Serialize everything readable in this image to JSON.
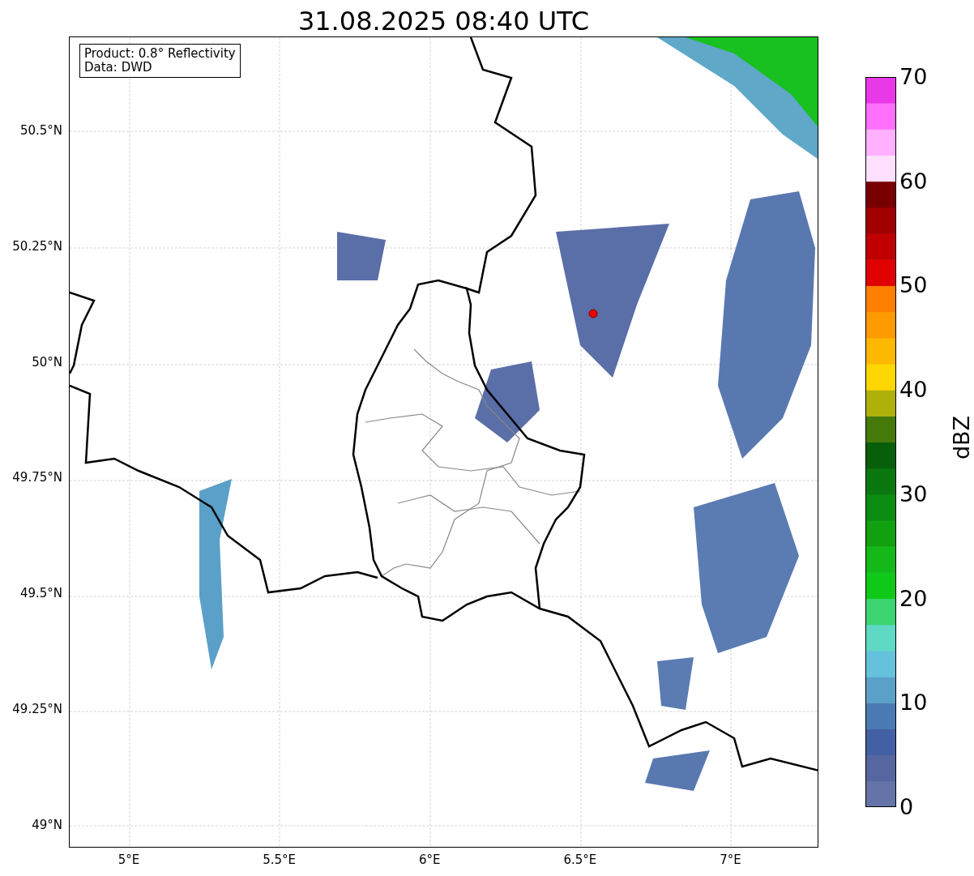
{
  "title": "31.08.2025 08:40 UTC",
  "info_box": [
    "Product: 0.8° Reflectivity",
    "Data: DWD"
  ],
  "latitude_labels": [
    "50.5°N",
    "50.25°N",
    "50°N",
    "49.75°N",
    "49.5°N",
    "49.25°N",
    "49°N"
  ],
  "longitude_labels": [
    "5°E",
    "5.5°E",
    "6°E",
    "6.5°E",
    "7°E"
  ],
  "colorbar": {
    "label": "dBZ",
    "ticks": [
      "70",
      "60",
      "50",
      "40",
      "30",
      "20",
      "10",
      "0"
    ]
  }
}
